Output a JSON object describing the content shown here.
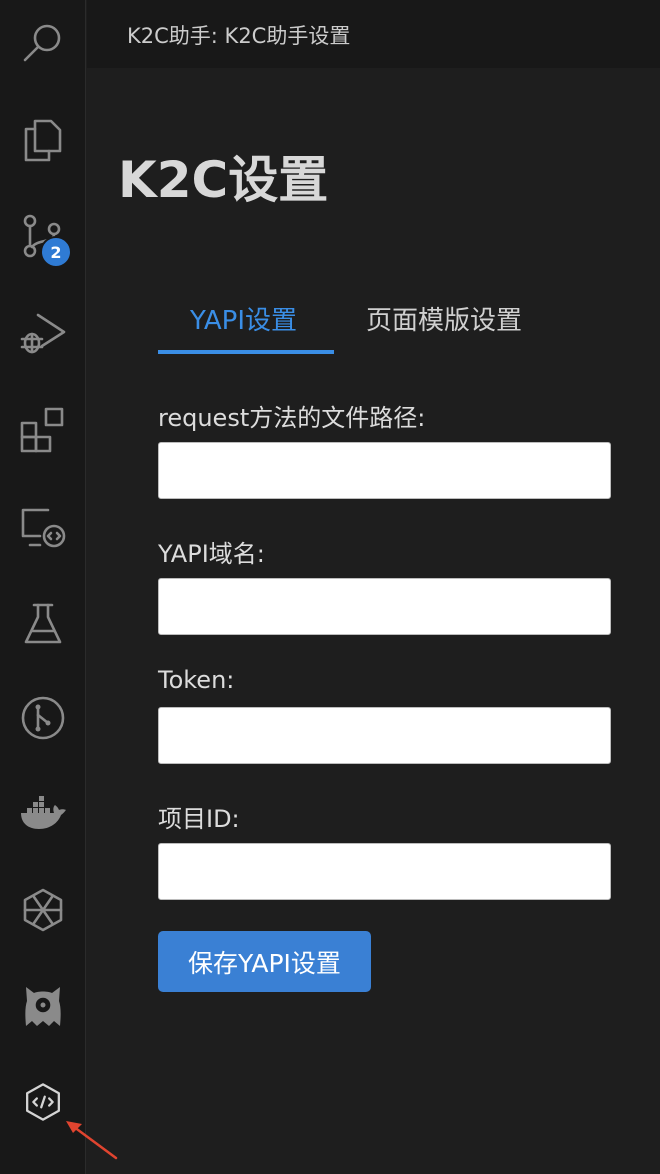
{
  "activity_bar": {
    "source_control_badge": "2",
    "icons": [
      "search-icon",
      "explorer-icon",
      "source-control-icon",
      "run-debug-icon",
      "extensions-icon",
      "remote-explorer-icon",
      "testing-icon",
      "git-graph-icon",
      "docker-icon",
      "k8s-icon",
      "ghost-extension-icon",
      "k2c-helper-icon"
    ]
  },
  "tab": {
    "title": "K2C助手: K2C助手设置"
  },
  "page": {
    "title": "K2C设置"
  },
  "tabs": [
    {
      "label": "YAPI设置",
      "active": true
    },
    {
      "label": "页面模版设置",
      "active": false
    }
  ],
  "form": {
    "fields": [
      {
        "label": "request方法的文件路径:",
        "value": ""
      },
      {
        "label": "YAPI域名:",
        "value": ""
      },
      {
        "label": "Token:",
        "value": ""
      },
      {
        "label": "项目ID:",
        "value": ""
      }
    ],
    "save_label": "保存YAPI设置"
  },
  "colors": {
    "accent": "#3a8ee6",
    "button": "#3a80d4",
    "badge": "#2f7bd4",
    "annotation_arrow": "#e0442f"
  }
}
